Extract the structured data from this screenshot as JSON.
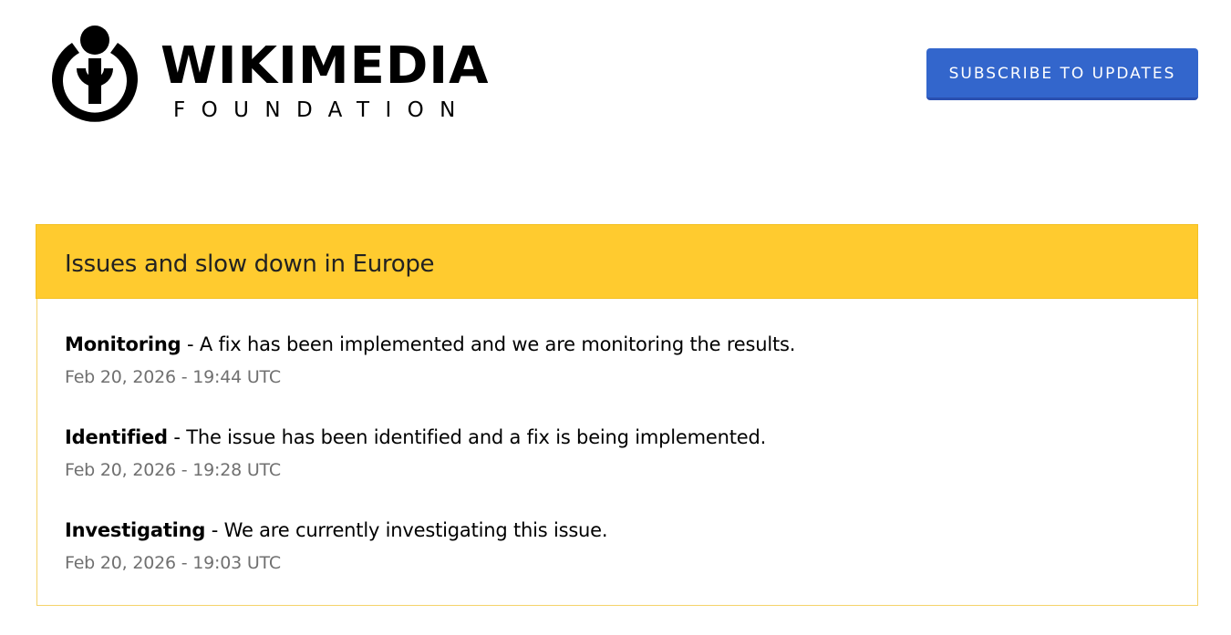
{
  "header": {
    "logo_word": "WIKIMEDIA",
    "logo_sub": "FOUNDATION",
    "subscribe_label": "SUBSCRIBE TO UPDATES"
  },
  "incident": {
    "title": "Issues and slow down in Europe",
    "updates": [
      {
        "status": "Monitoring",
        "separator": " - ",
        "message": "A fix has been implemented and we are monitoring the results.",
        "timestamp": "Feb 20, 2026 - 19:44 UTC"
      },
      {
        "status": "Identified",
        "separator": " - ",
        "message": "The issue has been identified and a fix is being implemented.",
        "timestamp": "Feb 20, 2026 - 19:28 UTC"
      },
      {
        "status": "Investigating",
        "separator": " - ",
        "message": "We are currently investigating this issue.",
        "timestamp": "Feb 20, 2026 - 19:03 UTC"
      }
    ]
  },
  "colors": {
    "accent": "#3366cc",
    "incident_header": "#ffcb2f",
    "incident_border": "#f5d36a",
    "timestamp": "#707070"
  },
  "icons": {
    "logo": "wikimedia-logo-icon"
  }
}
